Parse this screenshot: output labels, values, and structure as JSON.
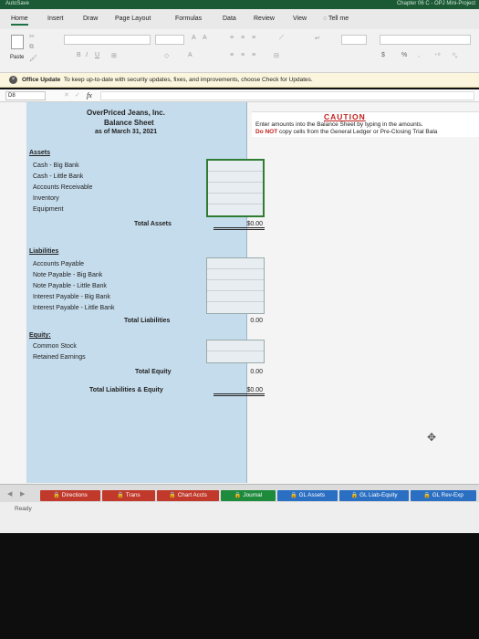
{
  "titlebar": {
    "autosave": "AutoSave",
    "title": "Chapter 06 C - OPJ Mini-Project"
  },
  "ribbon_tabs": [
    "Home",
    "Insert",
    "Draw",
    "Page Layout",
    "Formulas",
    "Data",
    "Review",
    "View"
  ],
  "tell_me": "Tell me",
  "paste_label": "Paste",
  "message_bar": {
    "label": "Office Update",
    "text": "To keep up-to-date with security updates, fixes, and improvements, choose Check for Updates."
  },
  "formula_bar": {
    "cell": "D8",
    "fx": "fx"
  },
  "sheet": {
    "company": "OverPriced Jeans, Inc.",
    "report": "Balance Sheet",
    "date": "as of March 31, 2021",
    "assets_heading": "Assets",
    "assets": [
      "Cash - Big Bank",
      "Cash - Little Bank",
      "Accounts Receivable",
      "Inventory",
      "Equipment"
    ],
    "total_assets_label": "Total Assets",
    "total_assets_value": "$0.00",
    "liabilities_heading": "Liabilities",
    "liabilities": [
      "Accounts Payable",
      "Note Payable - Big Bank",
      "Note Payable - Little Bank",
      "Interest Payable - Big Bank",
      "Interest Payable - Little Bank"
    ],
    "total_liabilities_label": "Total Liabilities",
    "total_liabilities_value": "0.00",
    "equity_heading": "Equity:",
    "equity": [
      "Common Stock",
      "Retained Earnings"
    ],
    "total_equity_label": "Total Equity",
    "total_equity_value": "0.00",
    "total_le_label": "Total Liabilities & Equity",
    "total_le_value": "$0.00"
  },
  "caution": {
    "title": "CAUTION",
    "line1": "Enter amounts into the Balance Sheet by typing in the amounts.",
    "line2_bold": "Do NOT",
    "line2_rest": " copy cells from the General Ledger or Pre-Closing Trial Bala"
  },
  "sheet_tabs": [
    {
      "label": "Directions",
      "color": "#c0392b"
    },
    {
      "label": "Trans",
      "color": "#c0392b"
    },
    {
      "label": "Chart Accts",
      "color": "#c0392b"
    },
    {
      "label": "Journal",
      "color": "#1e8a3c"
    },
    {
      "label": "GL Assets",
      "color": "#2b6fc2"
    },
    {
      "label": "GL Liab-Equity",
      "color": "#2b6fc2"
    },
    {
      "label": "GL Rev-Exp",
      "color": "#2b6fc2"
    }
  ],
  "status": {
    "text": "Ready"
  }
}
